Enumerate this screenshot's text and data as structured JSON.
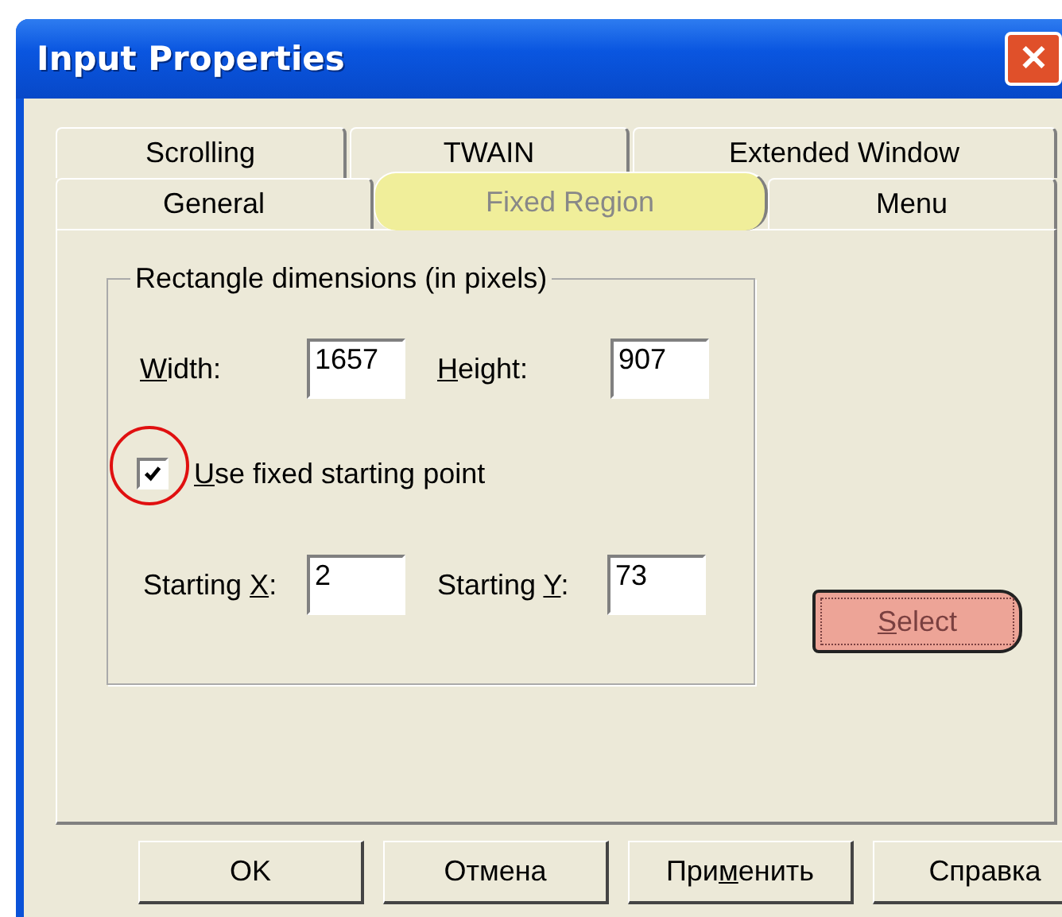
{
  "window": {
    "title": "Input Properties",
    "close": "✕"
  },
  "tab_rows": [
    [
      {
        "label": "Scrolling",
        "selected": false,
        "highlighted": false
      },
      {
        "label": "TWAIN",
        "selected": false,
        "highlighted": false
      },
      {
        "label": "Extended Window",
        "selected": false,
        "highlighted": false
      }
    ],
    [
      {
        "label": "General",
        "selected": false,
        "highlighted": false
      },
      {
        "label": "Fixed Region",
        "selected": true,
        "highlighted": true
      },
      {
        "label": "Menu",
        "selected": false,
        "highlighted": false
      }
    ]
  ],
  "group": {
    "title": "Rectangle dimensions (in pixels)",
    "size_fields": [
      {
        "label": [
          {
            "text": "W",
            "underlined": true
          },
          {
            "text": "idth:",
            "underlined": false
          }
        ],
        "value": "1657"
      },
      {
        "label": [
          {
            "text": "H",
            "underlined": true
          },
          {
            "text": "eight:",
            "underlined": false
          }
        ],
        "value": "907"
      }
    ],
    "checkbox": {
      "label": [
        {
          "text": "U",
          "underlined": true
        },
        {
          "text": "se fixed starting point",
          "underlined": false
        }
      ],
      "checked": true,
      "circled": true
    },
    "start_fields": [
      {
        "label": [
          {
            "text": "Starting ",
            "underlined": false
          },
          {
            "text": "X",
            "underlined": true
          },
          {
            "text": ":",
            "underlined": false
          }
        ],
        "value": "2"
      },
      {
        "label": [
          {
            "text": "Starting ",
            "underlined": false
          },
          {
            "text": "Y",
            "underlined": true
          },
          {
            "text": ":",
            "underlined": false
          }
        ],
        "value": "73"
      }
    ]
  },
  "select_button": {
    "label": [
      {
        "text": "S",
        "underlined": true
      },
      {
        "text": "elect",
        "underlined": false
      }
    ],
    "highlighted": true
  },
  "buttons": [
    {
      "label": [
        {
          "text": "OK",
          "underlined": false
        }
      ]
    },
    {
      "label": [
        {
          "text": "Отмена",
          "underlined": false
        }
      ]
    },
    {
      "label": [
        {
          "text": "При",
          "underlined": false
        },
        {
          "text": "м",
          "underlined": true
        },
        {
          "text": "енить",
          "underlined": false
        }
      ]
    },
    {
      "label": [
        {
          "text": "Справка",
          "underlined": false
        }
      ]
    }
  ]
}
